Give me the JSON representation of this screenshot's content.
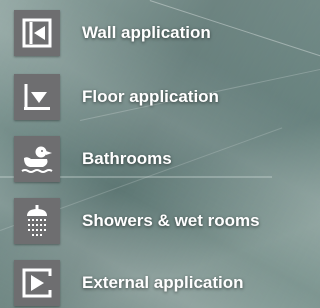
{
  "menu": {
    "items": [
      {
        "label": "Wall application",
        "icon": "wall-application-icon"
      },
      {
        "label": "Floor application",
        "icon": "floor-application-icon"
      },
      {
        "label": "Bathrooms",
        "icon": "rubber-duck-icon"
      },
      {
        "label": "Showers & wet rooms",
        "icon": "shower-head-icon"
      },
      {
        "label": "External application",
        "icon": "external-application-icon"
      }
    ]
  },
  "colors": {
    "icon_box": "#6e6e70",
    "icon_glyph": "#ffffff",
    "label_text": "#ffffff"
  }
}
